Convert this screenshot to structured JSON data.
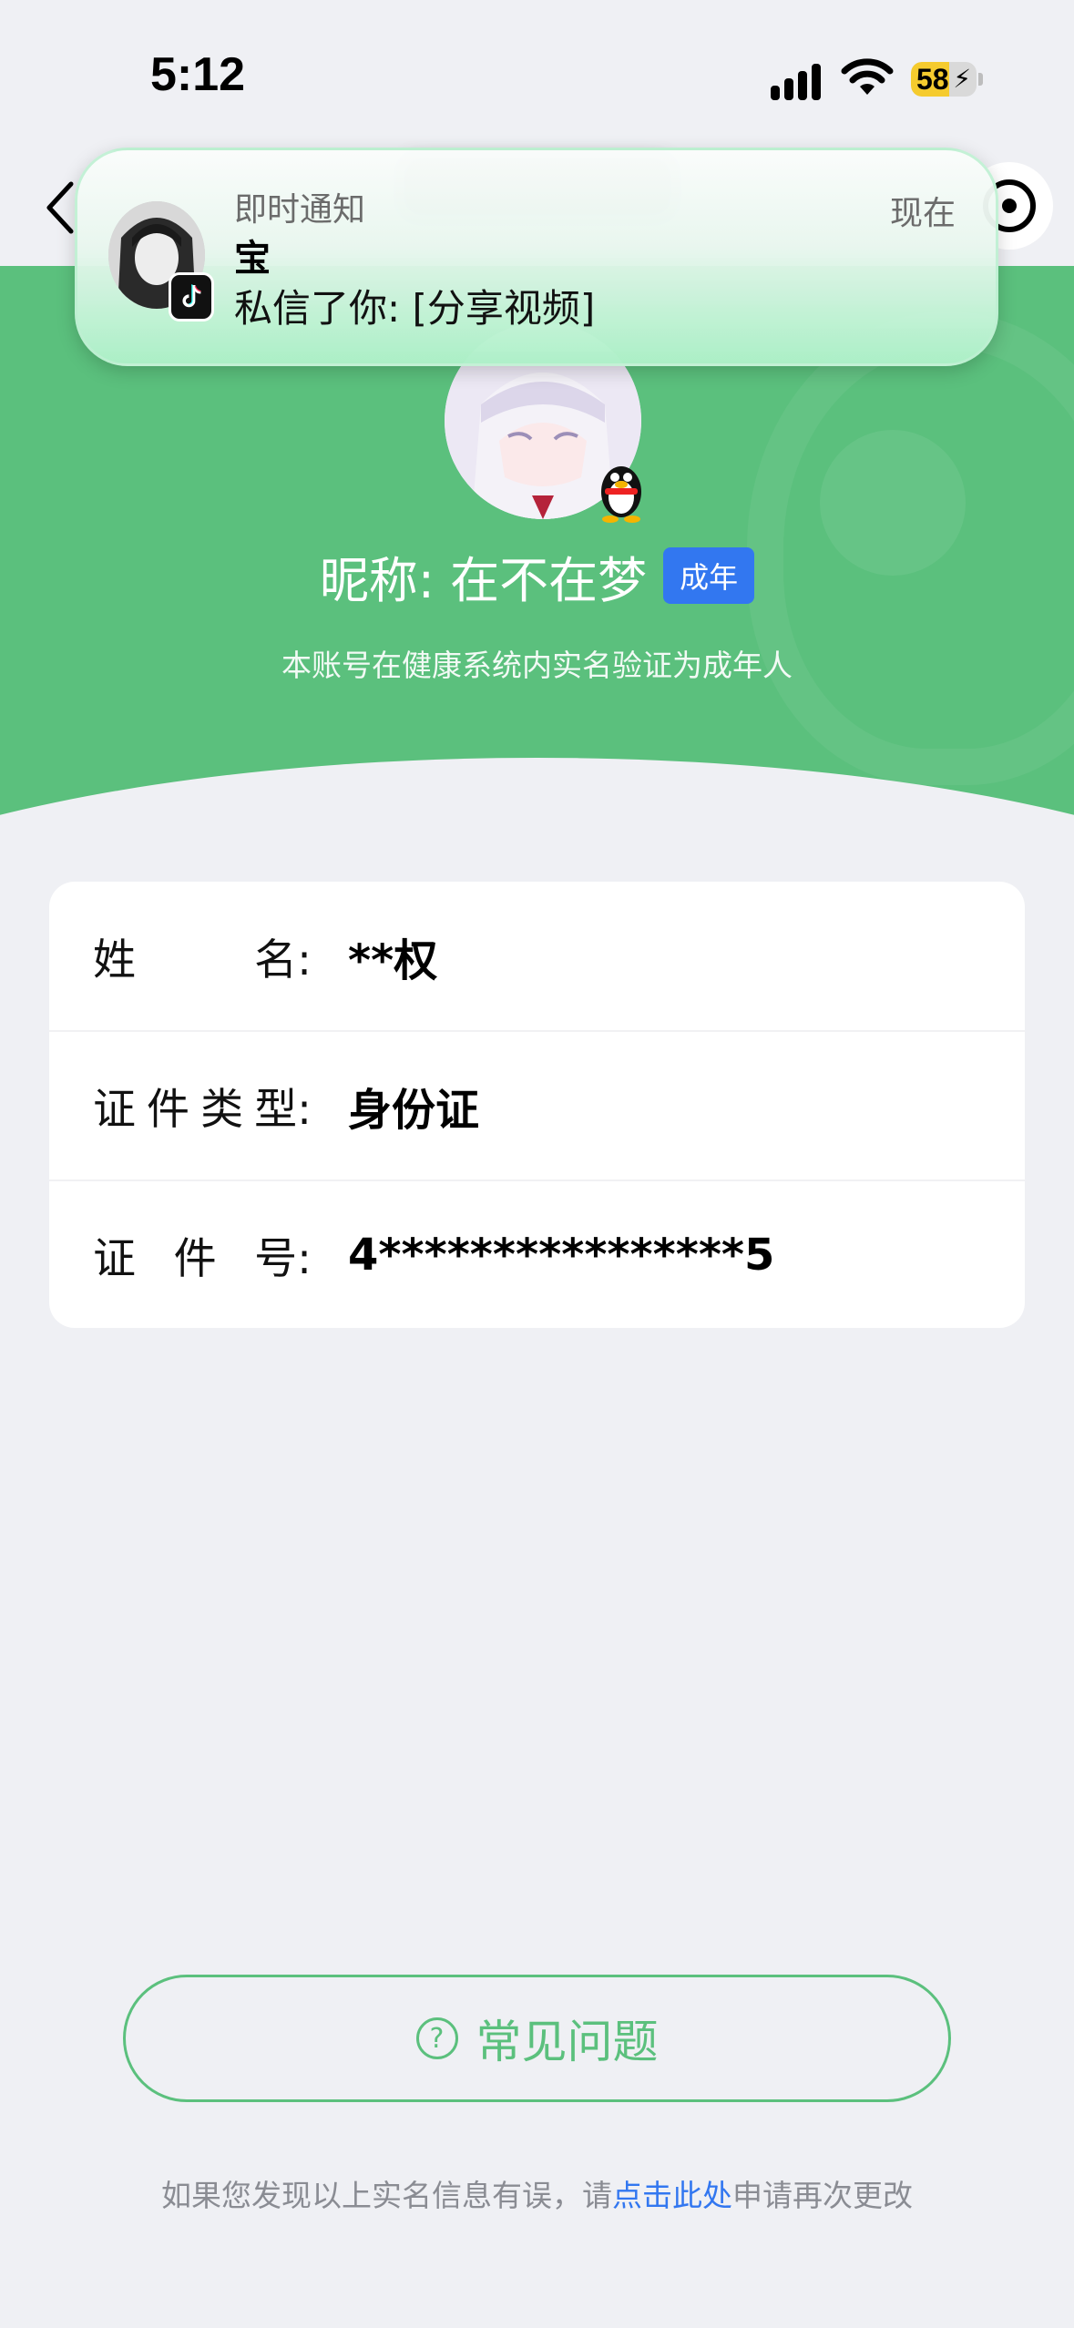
{
  "status_bar": {
    "time": "5:12",
    "battery_level": "58",
    "battery_fraction": 0.58,
    "icons": [
      "signal-icon",
      "wifi-icon",
      "battery-charging-icon"
    ]
  },
  "notification": {
    "app_name": "即时通知",
    "sender": "宝",
    "message": "私信了你: [分享视频]",
    "time": "现在",
    "app_icon": "tiktok-icon"
  },
  "profile": {
    "nickname": "昵称: 在不在梦",
    "badge": "成年",
    "subtitle": "本账号在健康系统内实名验证为成年人",
    "platform_icon": "qq-penguin-icon"
  },
  "info": {
    "rows": [
      {
        "label": "姓名:",
        "label_chars": [
          "姓",
          "名:"
        ],
        "value": "**权"
      },
      {
        "label": "证件类型:",
        "label_chars": [
          "证",
          "件",
          "类",
          "型:"
        ],
        "value": "身份证"
      },
      {
        "label": "证件号:",
        "label_chars": [
          "证",
          "件",
          "号:"
        ],
        "value": "4****************5"
      }
    ]
  },
  "faq": {
    "label": "常见问题",
    "icon": "question-circle-icon"
  },
  "footer": {
    "prefix": "如果您发现以上实名信息有误，请",
    "link": "点击此处",
    "suffix": "申请再次更改"
  },
  "colors": {
    "brand_green": "#5BC07D",
    "badge_blue": "#3277F0",
    "background": "#EFF0F4",
    "link_blue": "#3277F0"
  }
}
